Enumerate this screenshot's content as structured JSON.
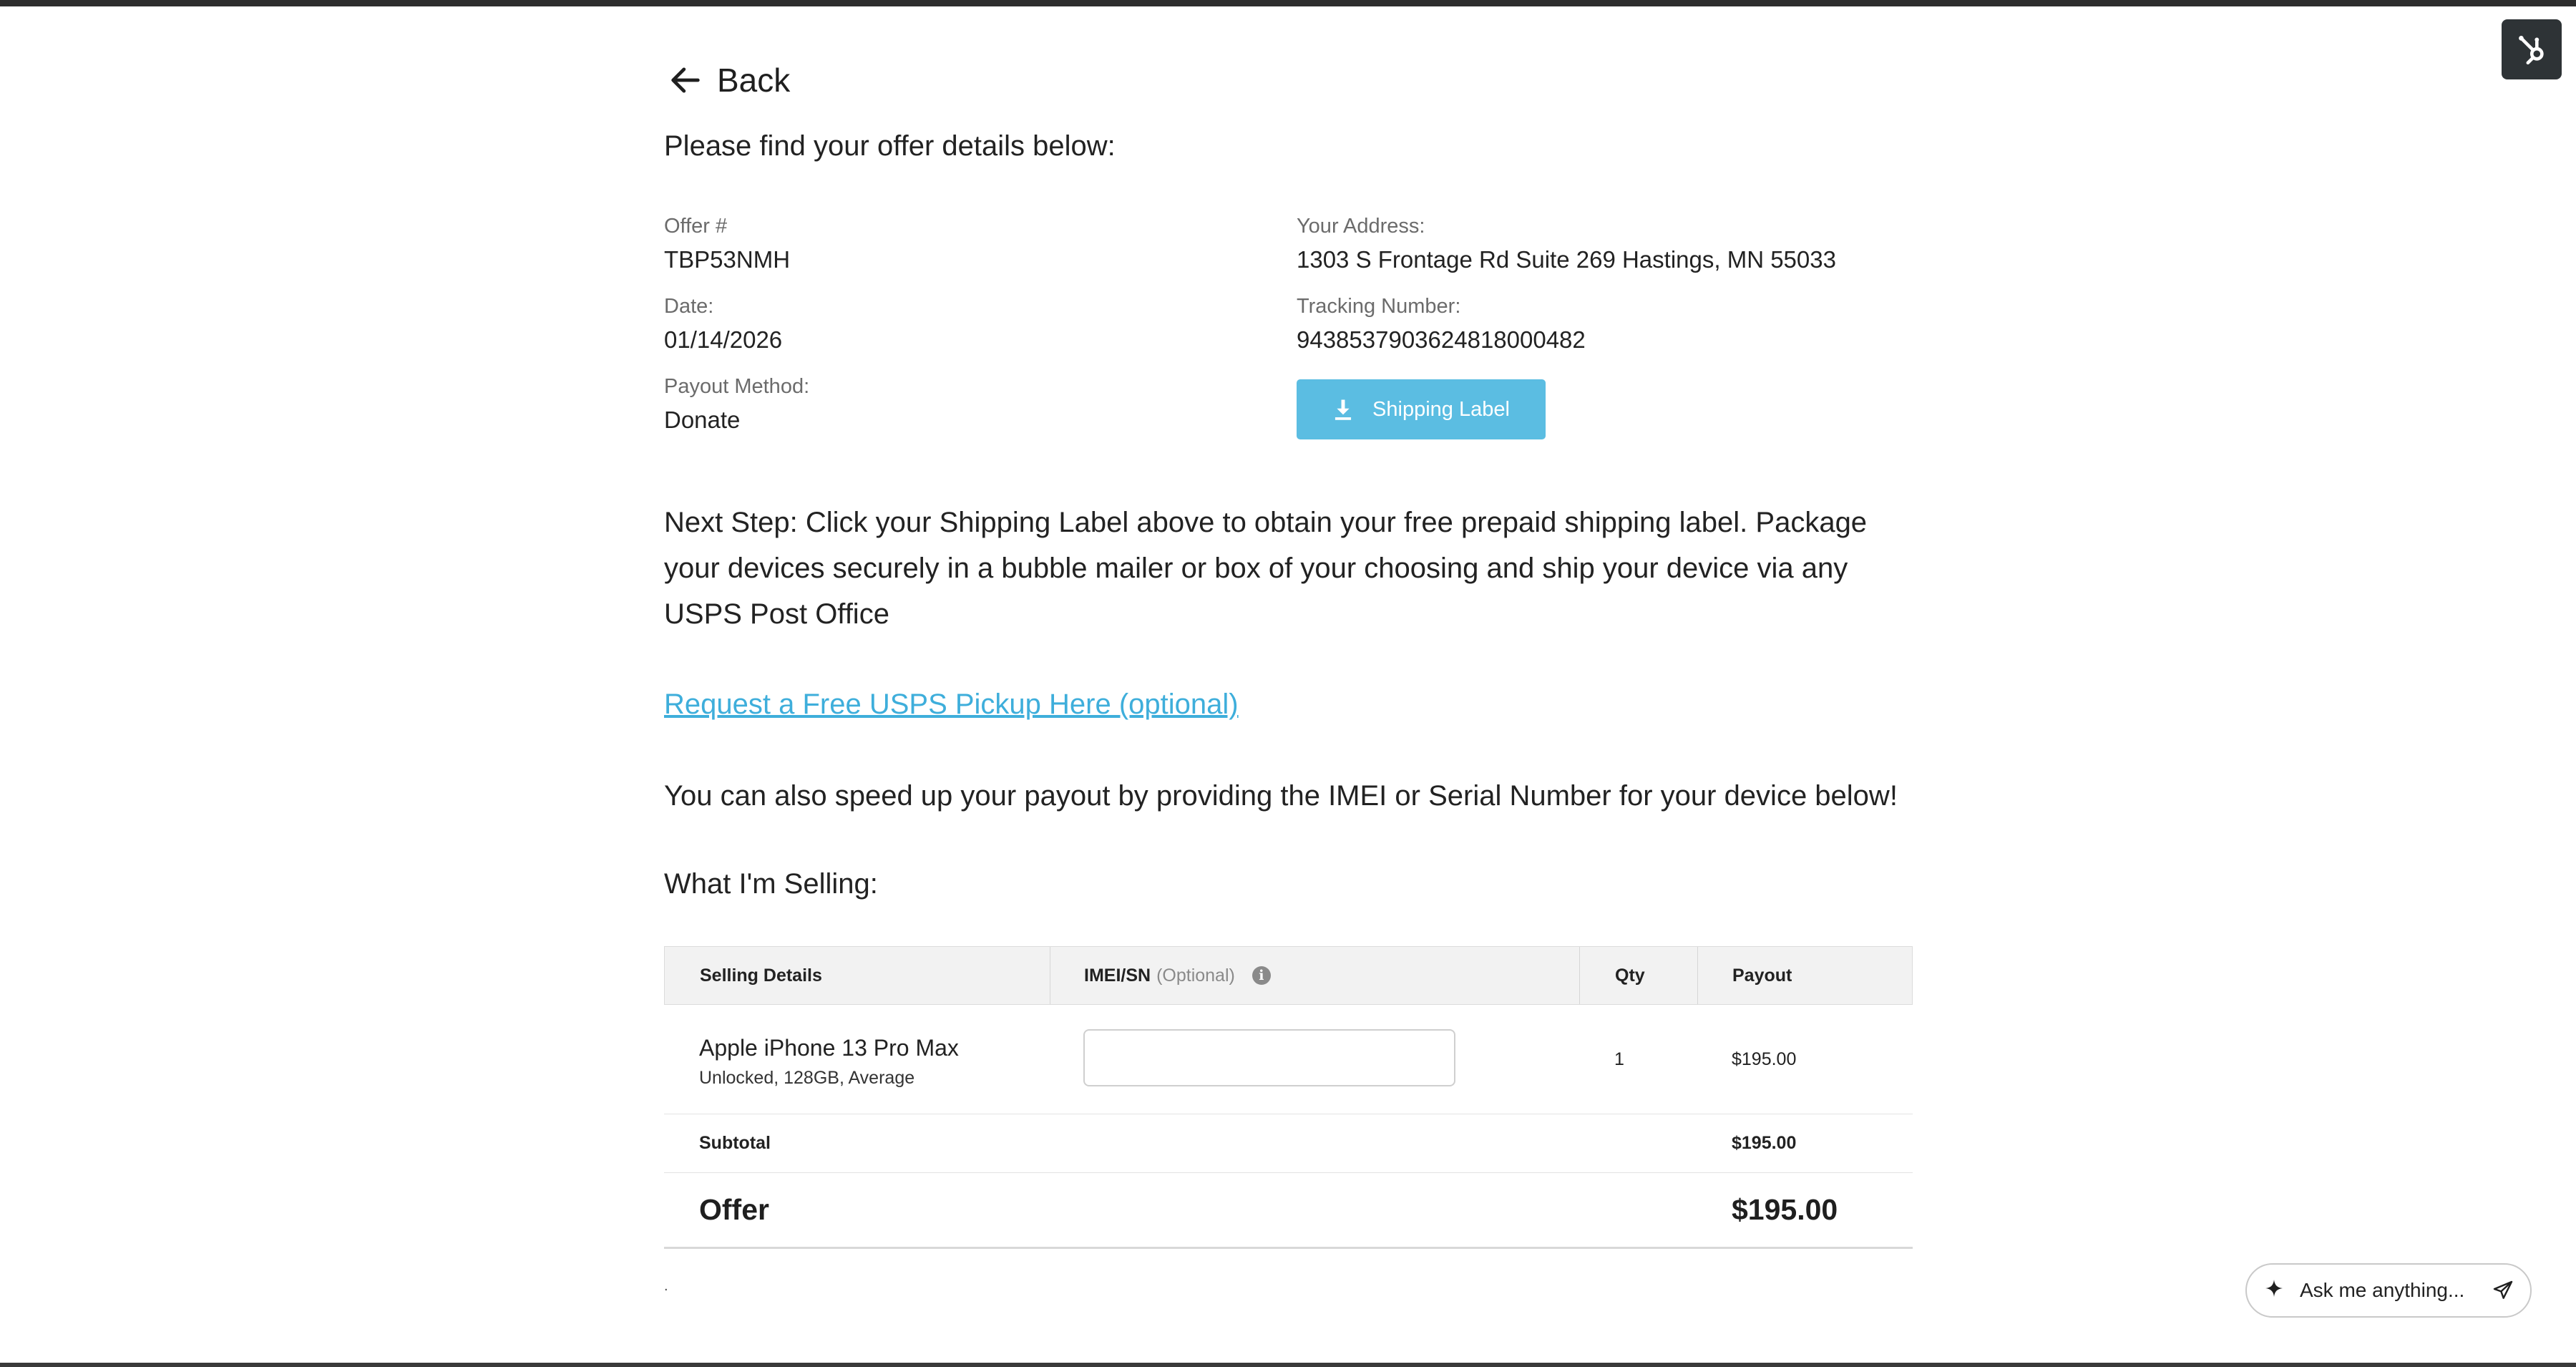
{
  "nav": {
    "back_label": "Back"
  },
  "intro_text": "Please find your offer details below:",
  "offer_details": {
    "offer_label": "Offer #",
    "offer_number": "TBP53NMH",
    "date_label": "Date:",
    "date": "01/14/2026",
    "payout_method_label": "Payout Method:",
    "payout_method": "Donate",
    "address_label": "Your Address:",
    "address": "1303 S Frontage Rd Suite 269 Hastings, MN 55033",
    "tracking_label": "Tracking Number:",
    "tracking_number": "9438537903624818000482",
    "shipping_label_button": "Shipping Label"
  },
  "next_step_text": "Next Step: Click your Shipping Label above to obtain your free prepaid shipping label. Package your devices securely in a bubble mailer or box of your choosing and ship your device via any USPS Post Office",
  "pickup_link": "Request a Free USPS Pickup Here (optional)",
  "speed_up_text": "You can also speed up your payout by providing the IMEI or Serial Number for your device below!",
  "selling_title": "What I'm Selling:",
  "table": {
    "headers": {
      "details": "Selling Details",
      "imei": "IMEI/SN",
      "imei_optional": "(Optional)",
      "qty": "Qty",
      "payout": "Payout"
    },
    "items": [
      {
        "name": "Apple iPhone 13 Pro Max",
        "description": "Unlocked, 128GB, Average",
        "imei_value": "",
        "qty": "1",
        "payout": "$195.00"
      }
    ],
    "subtotal_label": "Subtotal",
    "subtotal": "$195.00",
    "offer_label": "Offer",
    "offer_total": "$195.00"
  },
  "assistant": {
    "placeholder": "Ask me anything..."
  },
  "colors": {
    "accent": "#5bbde2",
    "link": "#3eaedb",
    "header_bg": "#f2f2f2",
    "widget_bg": "#2e3336"
  },
  "icons": {
    "back": "arrow-left-icon",
    "download": "download-icon",
    "info": "info-icon",
    "hub": "hubspot-sprocket-icon",
    "sparkle": "sparkle-icon",
    "send": "send-icon"
  }
}
